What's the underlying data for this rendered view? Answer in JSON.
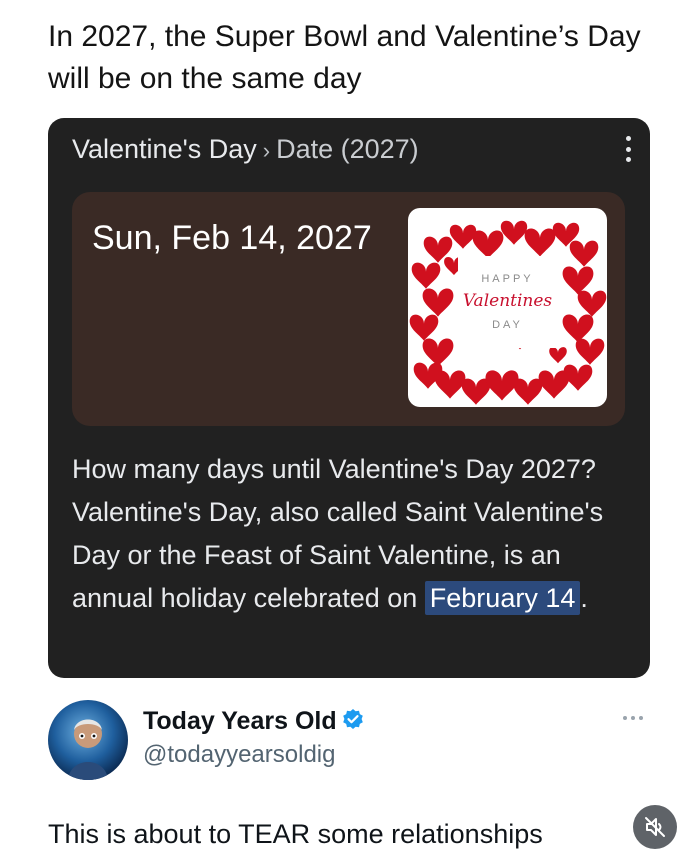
{
  "post": {
    "headline": "In 2027, the Super Bowl and Valentine’s Day will be on the same day"
  },
  "search_card": {
    "breadcrumb_topic": "Valentine's Day",
    "breadcrumb_separator": "›",
    "breadcrumb_section": "Date (2027)",
    "date_value": "Sun, Feb 14, 2027",
    "image": {
      "line1": "HAPPY",
      "line2": "Valentines",
      "line3": "DAY"
    },
    "description_before": "How many days until Valentine's Day 2027? Valentine's Day, also called Saint Valentine's Day or the Feast of Saint Valentine, is an annual holiday celebrated on ",
    "description_highlight": "February 14",
    "description_after": "."
  },
  "tweet": {
    "display_name": "Today Years Old",
    "handle": "@todayyearsoldig",
    "text": "This is about to TEAR some relationships"
  },
  "colors": {
    "card_bg": "#212121",
    "date_box_bg": "#3a2a25",
    "highlight_bg": "#2c4a7c",
    "verified_blue": "#1d9bf0",
    "heart_red": "#d0101e"
  },
  "icons": {
    "more_vertical": "more-vertical-icon",
    "verified": "verified-badge-icon",
    "more_horizontal": "more-horizontal-icon",
    "mute": "volume-muted-icon"
  }
}
